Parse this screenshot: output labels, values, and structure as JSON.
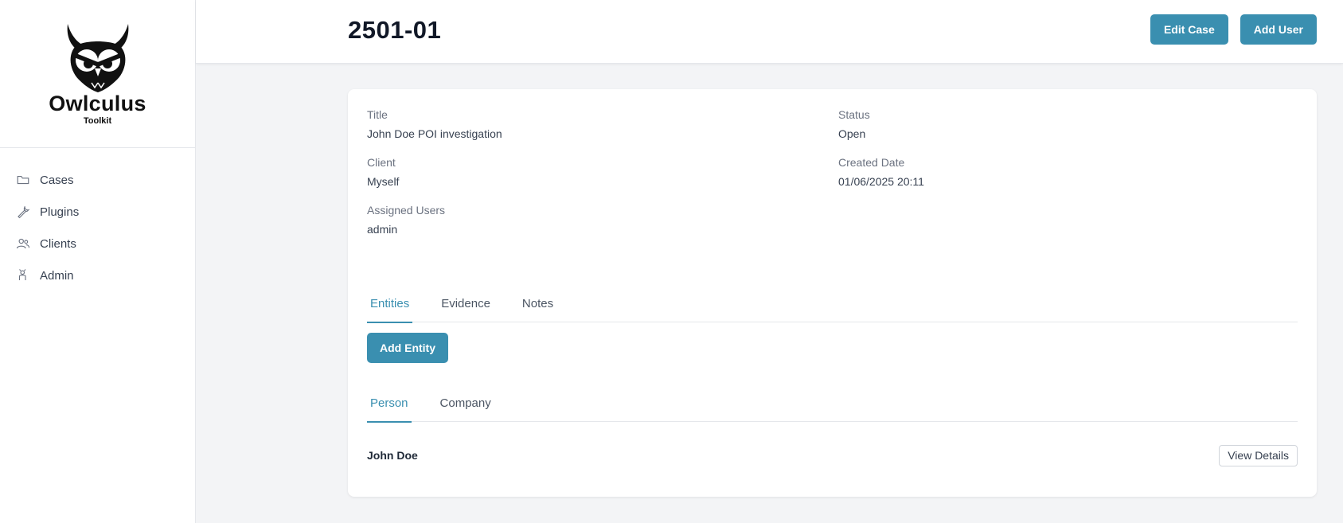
{
  "brand": {
    "name": "Owlculus",
    "subtitle": "Toolkit"
  },
  "sidebar": {
    "items": [
      {
        "label": "Cases",
        "icon": "folder-icon"
      },
      {
        "label": "Plugins",
        "icon": "wrench-icon"
      },
      {
        "label": "Clients",
        "icon": "users-icon"
      },
      {
        "label": "Admin",
        "icon": "admin-icon"
      }
    ]
  },
  "header": {
    "case_id": "2501-01",
    "edit_case_label": "Edit Case",
    "add_user_label": "Add User"
  },
  "case_info": {
    "title_label": "Title",
    "title_value": "John Doe POI investigation",
    "status_label": "Status",
    "status_value": "Open",
    "client_label": "Client",
    "client_value": "Myself",
    "created_label": "Created Date",
    "created_value": "01/06/2025 20:11",
    "users_label": "Assigned Users",
    "users_value": "admin"
  },
  "tabs": [
    {
      "label": "Entities",
      "active": true
    },
    {
      "label": "Evidence",
      "active": false
    },
    {
      "label": "Notes",
      "active": false
    }
  ],
  "entities": {
    "add_label": "Add Entity",
    "subtabs": [
      {
        "label": "Person",
        "active": true
      },
      {
        "label": "Company",
        "active": false
      }
    ],
    "rows": [
      {
        "name": "John Doe",
        "action_label": "View Details"
      }
    ]
  },
  "colors": {
    "accent": "#3a8fb0",
    "background": "#f3f4f6"
  }
}
